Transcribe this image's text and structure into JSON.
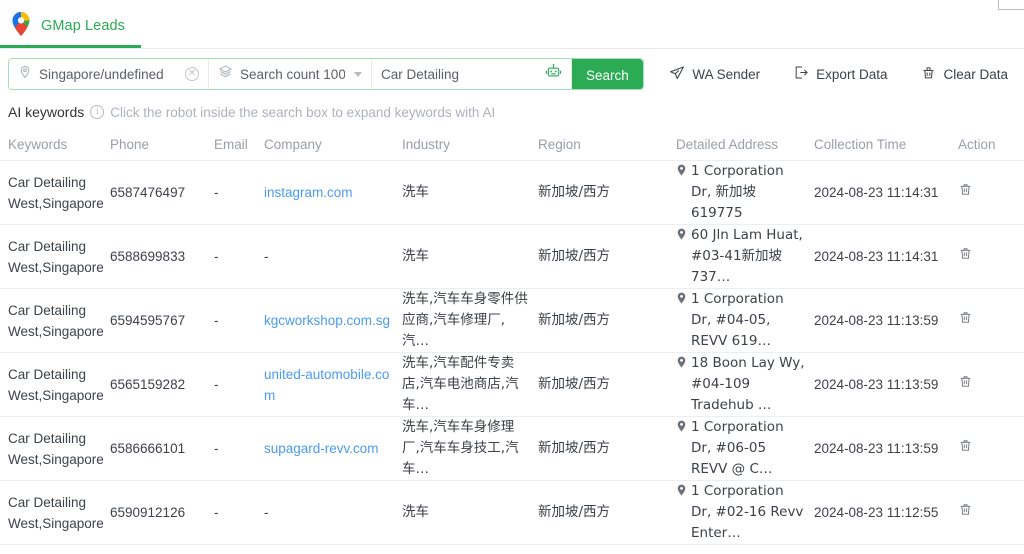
{
  "window": {
    "frame_hint": "window-corner"
  },
  "tabs": [
    {
      "label": "GMap Leads",
      "icon": "map-pin-icon",
      "active": true
    }
  ],
  "toolbar": {
    "location": {
      "icon": "location-pin-icon",
      "value": "Singapore/undefined",
      "clear_icon": "clear-circle-icon"
    },
    "count": {
      "icon": "layers-icon",
      "value": "Search count 100(",
      "chevron_icon": "chevron-down-icon"
    },
    "keyword": {
      "icon": "robot-icon",
      "value": "Car Detailing",
      "placeholder": "Car Detailing"
    },
    "search_label": "Search",
    "accent_color": "#2bab54",
    "actions": [
      {
        "label": "WA Sender",
        "icon": "send-plane-icon"
      },
      {
        "label": "Export Data",
        "icon": "export-icon"
      },
      {
        "label": "Clear Data",
        "icon": "broom-icon"
      }
    ]
  },
  "ai_keywords": {
    "title": "AI keywords",
    "info_icon": "info-circle-icon",
    "hint": "Click the robot inside the search box to expand keywords with AI"
  },
  "table": {
    "columns": [
      "Keywords",
      "Phone",
      "Email",
      "Company",
      "Industry",
      "Region",
      "Detailed Address",
      "Collection Time",
      "Action"
    ],
    "delete_icon": "trash-icon",
    "address_icon": "map-marker-icon",
    "rows": [
      {
        "keywords": "Car Detailing West,Singapore",
        "phone": "6587476497",
        "email": "-",
        "company": "instagram.com",
        "company_is_link": true,
        "industry": "洗车",
        "region": "新加坡/西方",
        "address": "1 Corporation Dr, 新加坡 619775",
        "collection_time": "2024-08-23 11:14:31"
      },
      {
        "keywords": "Car Detailing West,Singapore",
        "phone": "6588699833",
        "email": "-",
        "company": "-",
        "company_is_link": false,
        "industry": "洗车",
        "region": "新加坡/西方",
        "address": "60 Jln Lam Huat, #03-41新加坡 737…",
        "collection_time": "2024-08-23 11:14:31"
      },
      {
        "keywords": "Car Detailing West,Singapore",
        "phone": "6594595767",
        "email": "-",
        "company": "kgcworkshop.com.sg",
        "company_is_link": true,
        "industry": "洗车,汽车车身零件供应商,汽车修理厂,汽…",
        "region": "新加坡/西方",
        "address": "1 Corporation Dr, #04-05, REVV 619…",
        "collection_time": "2024-08-23 11:13:59"
      },
      {
        "keywords": "Car Detailing West,Singapore",
        "phone": "6565159282",
        "email": "-",
        "company": "united-automobile.com",
        "company_is_link": true,
        "industry": "洗车,汽车配件专卖店,汽车电池商店,汽车…",
        "region": "新加坡/西方",
        "address": "18 Boon Lay Wy, #04-109 Tradehub …",
        "collection_time": "2024-08-23 11:13:59"
      },
      {
        "keywords": "Car Detailing West,Singapore",
        "phone": "6586666101",
        "email": "-",
        "company": "supagard-revv.com",
        "company_is_link": true,
        "industry": "洗车,汽车车身修理厂,汽车车身技工,汽车…",
        "region": "新加坡/西方",
        "address": "1 Corporation Dr, #06-05 REVV @ C…",
        "collection_time": "2024-08-23 11:13:59"
      },
      {
        "keywords": "Car Detailing West,Singapore",
        "phone": "6590912126",
        "email": "-",
        "company": "-",
        "company_is_link": false,
        "industry": "洗车",
        "region": "新加坡/西方",
        "address": "1 Corporation Dr, #02-16 Revv Enter…",
        "collection_time": "2024-08-23 11:12:55"
      }
    ]
  }
}
